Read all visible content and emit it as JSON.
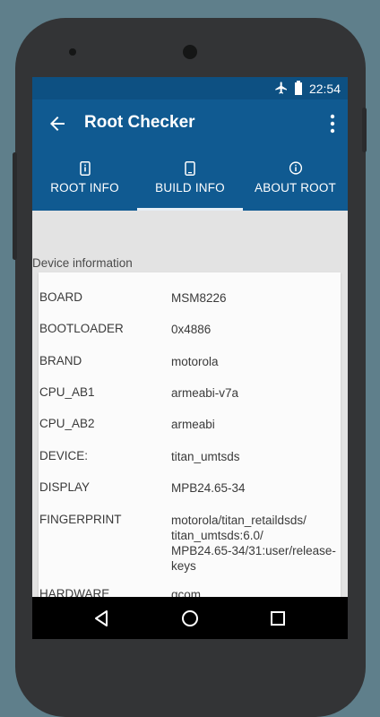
{
  "status": {
    "time": "22:54"
  },
  "appbar": {
    "title": "Root Checker"
  },
  "tabs": [
    {
      "label": "ROOT INFO",
      "icon": "phone-info-icon"
    },
    {
      "label": "BUILD INFO",
      "icon": "phone-icon"
    },
    {
      "label": "ABOUT ROOT",
      "icon": "info-circle-icon"
    }
  ],
  "selected_tab": "BUILD INFO",
  "section": {
    "title": "Device information"
  },
  "rows": [
    {
      "key": "BOARD",
      "value": "MSM8226"
    },
    {
      "key": "BOOTLOADER",
      "value": "0x4886"
    },
    {
      "key": "BRAND",
      "value": "motorola"
    },
    {
      "key": "CPU_AB1",
      "value": "armeabi-v7a"
    },
    {
      "key": "CPU_AB2",
      "value": "armeabi"
    },
    {
      "key": "DEVICE:",
      "value": "titan_umtsds"
    },
    {
      "key": "DISPLAY",
      "value": "MPB24.65-34"
    },
    {
      "key": "FINGERPRINT",
      "value": "motorola/titan_retaildsds/\ntitan_umtsds:6.0/\nMPB24.65-34/31:user/release-\nkeys"
    },
    {
      "key": "HARDWARE",
      "value": "qcom"
    }
  ],
  "colors": {
    "primary": "#105a91",
    "status_bar": "#0d5082",
    "background": "#5f7f8b"
  }
}
